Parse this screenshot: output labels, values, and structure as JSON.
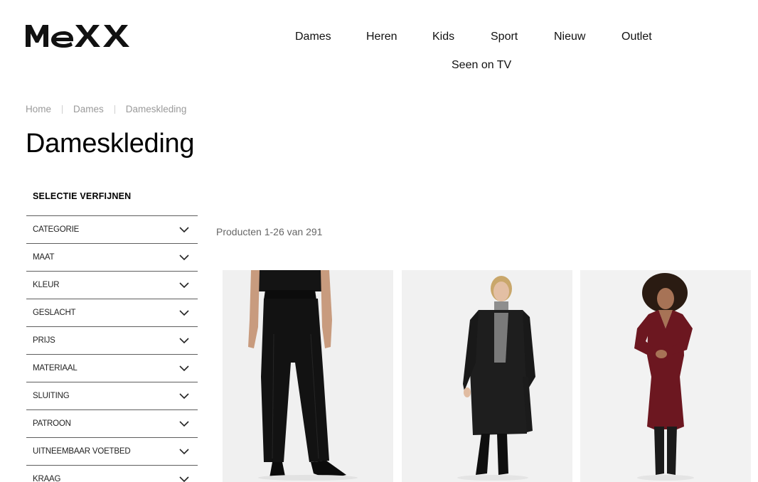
{
  "brand": {
    "logo_text": "MEXX"
  },
  "nav": {
    "items": [
      "Dames",
      "Heren",
      "Kids",
      "Sport",
      "Nieuw",
      "Outlet",
      "Seen on TV"
    ]
  },
  "breadcrumb": [
    "Home",
    "Dames",
    "Dameskleding"
  ],
  "page": {
    "title": "Dameskleding"
  },
  "filters": {
    "title": "SELECTIE VERFIJNEN",
    "items": [
      "CATEGORIE",
      "MAAT",
      "KLEUR",
      "GESLACHT",
      "PRIJS",
      "MATERIAAL",
      "SLUITING",
      "PATROON",
      "UITNEEMBAAR VOETBED",
      "KRAAG"
    ]
  },
  "results": {
    "count_text": "Producten 1-26 van 291"
  },
  "products": [
    {
      "image": "black-pants-image",
      "color": "#111111"
    },
    {
      "image": "black-coat-image",
      "color": "#1c1c1c"
    },
    {
      "image": "burgundy-dress-image",
      "color": "#6b1620"
    }
  ]
}
